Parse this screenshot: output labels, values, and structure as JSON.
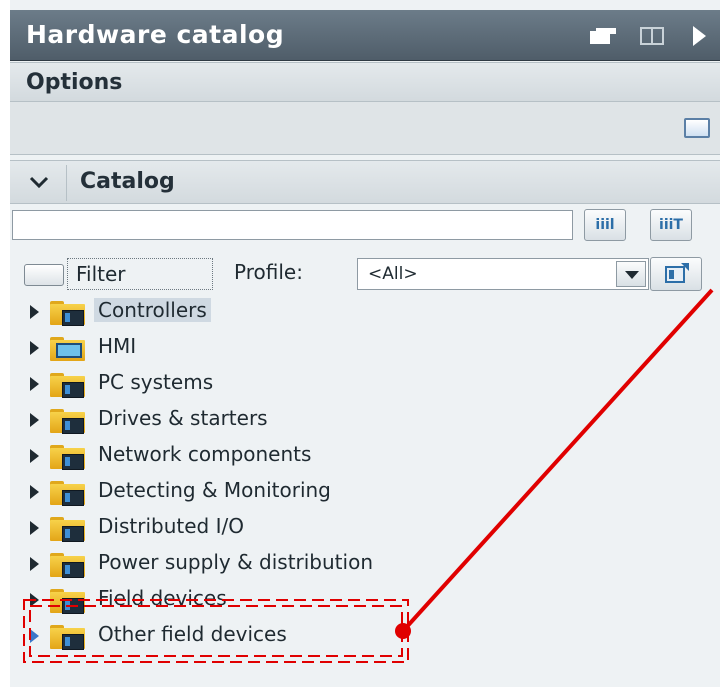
{
  "window": {
    "title": "Hardware catalog"
  },
  "titlebar_icons": [
    "pin-icon",
    "split-view-icon",
    "collapse-arrow-icon"
  ],
  "options": {
    "label": "Options"
  },
  "catalog": {
    "label": "Catalog",
    "search": {
      "value": "",
      "placeholder": ""
    },
    "search_down_label": "iiil",
    "search_up_label": "iiiT",
    "filter": {
      "label": "Filter",
      "checked": false
    },
    "profile": {
      "label": "Profile:",
      "selected": "<All>"
    }
  },
  "tree": {
    "items": [
      {
        "label": "Controllers",
        "icon": "controller-folder-icon",
        "selected": true
      },
      {
        "label": "HMI",
        "icon": "hmi-folder-icon"
      },
      {
        "label": "PC systems",
        "icon": "pc-folder-icon"
      },
      {
        "label": "Drives & starters",
        "icon": "drives-folder-icon"
      },
      {
        "label": "Network components",
        "icon": "network-folder-icon"
      },
      {
        "label": "Detecting & Monitoring",
        "icon": "detecting-folder-icon"
      },
      {
        "label": "Distributed I/O",
        "icon": "distributed-io-folder-icon"
      },
      {
        "label": "Power supply & distribution",
        "icon": "power-folder-icon"
      },
      {
        "label": "Field devices",
        "icon": "field-devices-folder-icon"
      },
      {
        "label": "Other field devices",
        "icon": "other-field-devices-folder-icon",
        "highlighted": true
      }
    ]
  },
  "annotation": {
    "color": "#e00000",
    "target": "Other field devices"
  }
}
